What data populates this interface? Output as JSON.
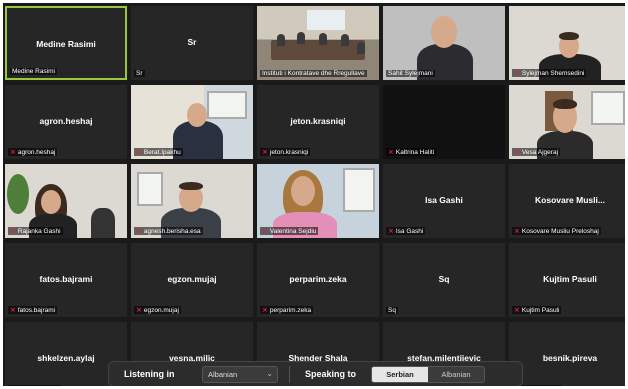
{
  "tiles": [
    {
      "center": "Medine Rasimi",
      "label": "Medine Rasimi",
      "muted": false,
      "active": true
    },
    {
      "center": "Sr",
      "label": "Sr",
      "muted": false
    },
    {
      "center": "",
      "label": "Instituti i Kontratave dhe Rregullave",
      "muted": false,
      "video": "room"
    },
    {
      "center": "",
      "label": "Sahit Sylejmani",
      "muted": false,
      "video": "man-grey"
    },
    {
      "center": "",
      "label": "Sylejman Shemsedini",
      "muted": true,
      "video": "man-dark"
    },
    {
      "center": "agron.heshaj",
      "label": "agron.heshaj",
      "muted": true
    },
    {
      "center": "",
      "label": "Berat.Ipakhu",
      "muted": true,
      "video": "man-office"
    },
    {
      "center": "jeton.krasniqi",
      "label": "jeton.krasniqi",
      "muted": true
    },
    {
      "center": "",
      "label": "Kaltrina Haliti",
      "muted": true,
      "video": "black"
    },
    {
      "center": "",
      "label": "Vesa Ajgeraj",
      "muted": true,
      "video": "man-shelf"
    },
    {
      "center": "",
      "label": "Rajanka Gashi",
      "muted": true,
      "video": "woman-dark"
    },
    {
      "center": "",
      "label": "agnesh.berisha.esa",
      "muted": true,
      "video": "man-room"
    },
    {
      "center": "",
      "label": "Valentina Sejdiu",
      "muted": true,
      "video": "woman-blonde"
    },
    {
      "center": "Isa Gashi",
      "label": "Isa Gashi",
      "muted": true
    },
    {
      "center": "Kosovare Musli...",
      "label": "Kosovare Musliu Preloshaj",
      "muted": true
    },
    {
      "center": "fatos.bajrami",
      "label": "fatos.bajrami",
      "muted": true
    },
    {
      "center": "egzon.mujaj",
      "label": "egzon.mujaj",
      "muted": true
    },
    {
      "center": "perparim.zeka",
      "label": "perparim.zeka",
      "muted": true
    },
    {
      "center": "Sq",
      "label": "Sq",
      "muted": false
    },
    {
      "center": "Kujtim Pasuli",
      "label": "Kujtim Pasuli",
      "muted": true
    },
    {
      "center": "shkelzen.aylaj",
      "label": "shkelzen.aylaj",
      "muted": true
    },
    {
      "center": "vesna.milic",
      "label": "",
      "muted": false
    },
    {
      "center": "Shender Shala",
      "label": "",
      "muted": false
    },
    {
      "center": "stefan.milentijevic",
      "label": "",
      "muted": false
    },
    {
      "center": "besnik.pireva",
      "label": "besnik.pireva",
      "muted": true
    }
  ],
  "interpretation": {
    "listening_label": "Listening in",
    "listening_value": "Albanian",
    "speaking_label": "Speaking to",
    "speaking_options": [
      "Serbian",
      "Albanian"
    ],
    "speaking_selected": "Serbian"
  },
  "colors": {
    "active_border": "#9ac83c",
    "muted_icon": "#e22233",
    "tile_bg": "#262626"
  },
  "icons": {
    "muted": "mic-off-icon",
    "chevron": "chevron-down-icon"
  }
}
